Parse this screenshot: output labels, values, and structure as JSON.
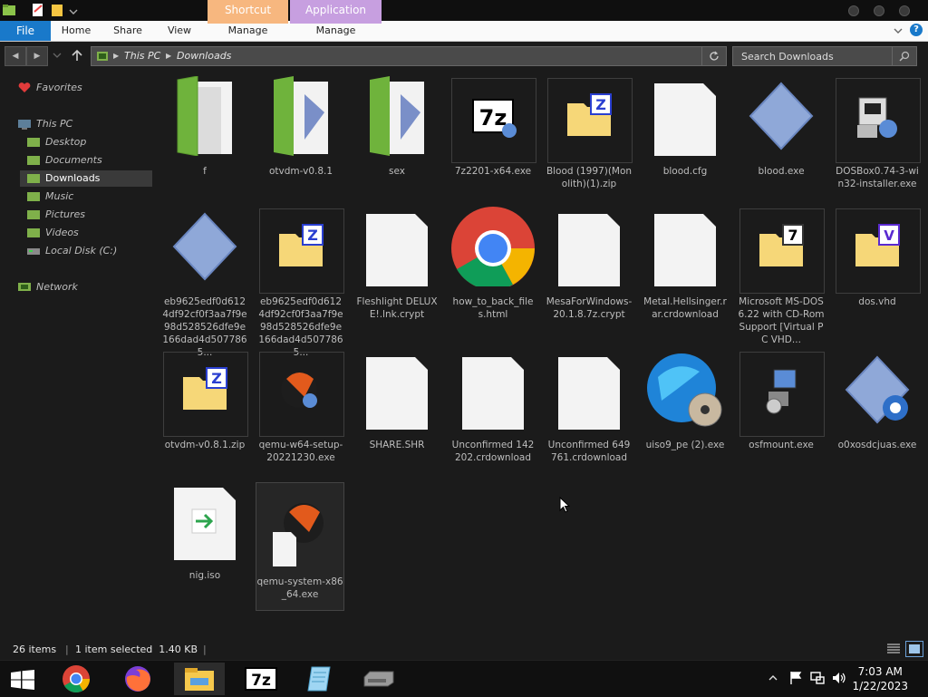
{
  "titlebar": {
    "contextual_tabs": [
      "Shortcut Tools",
      "Application Tools"
    ],
    "colors": {
      "shortcut_tools": "#f7b77f",
      "application_tools": "#c79fe0"
    }
  },
  "ribbon": {
    "file_label": "File",
    "tabs": [
      "Home",
      "Share",
      "View"
    ],
    "contextual_manage": [
      "Manage",
      "Manage"
    ]
  },
  "address": {
    "crumbs": [
      "This PC",
      "Downloads"
    ],
    "search_placeholder": "Search Downloads"
  },
  "nav": {
    "favorites": "Favorites",
    "this_pc": "This PC",
    "items": [
      "Desktop",
      "Documents",
      "Downloads",
      "Music",
      "Pictures",
      "Videos",
      "Local Disk (C:)"
    ],
    "network": "Network",
    "selected": "Downloads"
  },
  "files": [
    {
      "name": "f",
      "icon": "folder-icon"
    },
    {
      "name": "otvdm-v0.8.1",
      "icon": "folder-icon"
    },
    {
      "name": "sex",
      "icon": "folder-icon"
    },
    {
      "name": "7z2201-x64.exe",
      "icon": "7zip-installer-icon"
    },
    {
      "name": "Blood (1997)(Monolith)(1).zip",
      "icon": "zip-archive-icon"
    },
    {
      "name": "blood.cfg",
      "icon": "blank-file-icon"
    },
    {
      "name": "blood.exe",
      "icon": "executable-icon"
    },
    {
      "name": "DOSBox0.74-3-win32-installer.exe",
      "icon": "installer-icon"
    },
    {
      "name": "eb9625edf0d6124df92cf0f3aa7f9e98d528526dfe9e166dad4d5077865...",
      "icon": "executable-icon"
    },
    {
      "name": "eb9625edf0d6124df92cf0f3aa7f9e98d528526dfe9e166dad4d5077865...",
      "icon": "zip-archive-icon"
    },
    {
      "name": "Fleshlight DELUXE!.lnk.crypt",
      "icon": "blank-file-icon"
    },
    {
      "name": "how_to_back_files.html",
      "icon": "chrome-icon"
    },
    {
      "name": "MesaForWindows-20.1.8.7z.crypt",
      "icon": "blank-file-icon"
    },
    {
      "name": "Metal.Hellsinger.rar.crdownload",
      "icon": "blank-file-icon"
    },
    {
      "name": "Microsoft MS-DOS 6.22 with CD-Rom Support [Virtual PC VHD...",
      "icon": "7z-archive-icon"
    },
    {
      "name": "dos.vhd",
      "icon": "vhd-archive-icon"
    },
    {
      "name": "otvdm-v0.8.1.zip",
      "icon": "zip-archive-icon"
    },
    {
      "name": "qemu-w64-setup-20221230.exe",
      "icon": "qemu-installer-icon"
    },
    {
      "name": "SHARE.SHR",
      "icon": "blank-file-icon"
    },
    {
      "name": "Unconfirmed 142202.crdownload",
      "icon": "blank-file-icon"
    },
    {
      "name": "Unconfirmed 649761.crdownload",
      "icon": "blank-file-icon"
    },
    {
      "name": "uiso9_pe (2).exe",
      "icon": "ultraiso-icon"
    },
    {
      "name": "osfmount.exe",
      "icon": "osfmount-icon"
    },
    {
      "name": "o0xosdcjuas.exe",
      "icon": "executable-icon"
    },
    {
      "name": "nig.iso",
      "icon": "iso-file-icon"
    },
    {
      "name": "qemu-system-x86_64.exe",
      "icon": "qemu-icon"
    }
  ],
  "status": {
    "count": "26 items",
    "selection": "1 item selected  1.40 KB"
  },
  "taskbar": {
    "apps": [
      "start-icon",
      "chrome-icon",
      "firefox-icon",
      "file-explorer-icon",
      "7zip-icon",
      "notepad-icon",
      "drive-icon"
    ],
    "time": "7:03 AM",
    "date": "1/22/2023"
  }
}
